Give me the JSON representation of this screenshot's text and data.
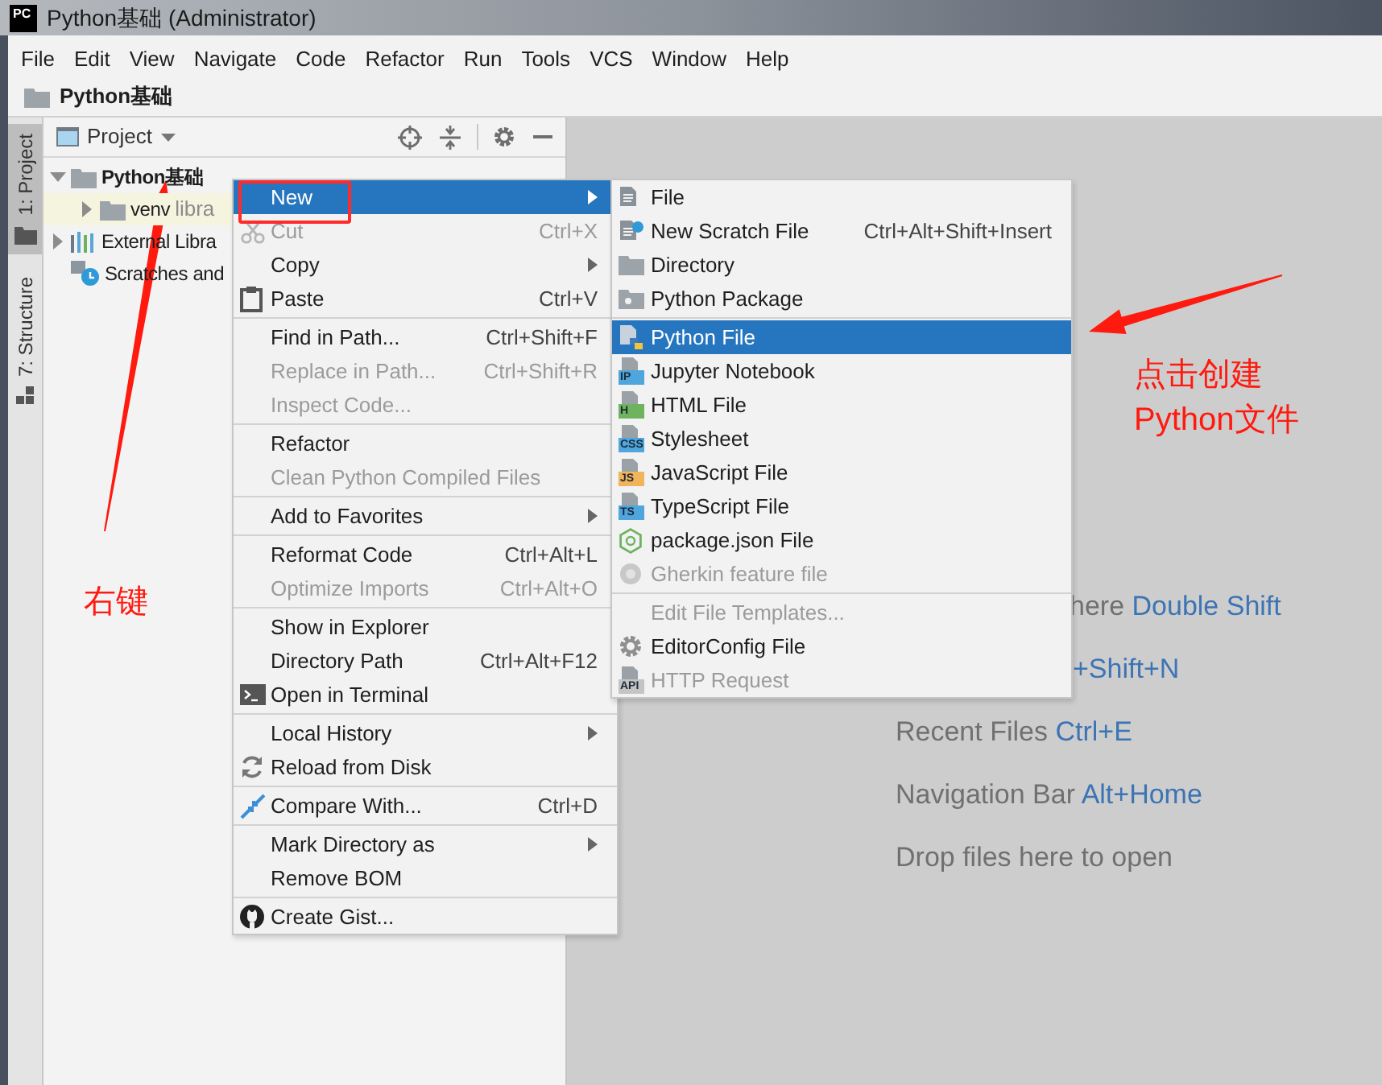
{
  "window": {
    "app_icon_text": "PC",
    "title": "Python基础 (Administrator)"
  },
  "menu_bar": [
    "File",
    "Edit",
    "View",
    "Navigate",
    "Code",
    "Refactor",
    "Run",
    "Tools",
    "VCS",
    "Window",
    "Help"
  ],
  "nav_bar": {
    "label": "Python基础"
  },
  "tool_tabs": [
    {
      "label": "1: Project",
      "selected": true
    },
    {
      "label": "7: Structure",
      "selected": false
    }
  ],
  "project_panel": {
    "title": "Project",
    "tree": [
      {
        "kind": "folder",
        "label": "Python基础",
        "expanded": true,
        "highlighted": false,
        "children": [
          {
            "kind": "folder",
            "label": "venv",
            "note": "libra",
            "expanded": false,
            "highlighted": true
          }
        ]
      },
      {
        "kind": "library",
        "label": "External Libra",
        "expanded": false,
        "highlighted": false
      },
      {
        "kind": "scratches",
        "label": "Scratches and",
        "highlighted": false
      }
    ]
  },
  "context_menu": {
    "groups": [
      [
        {
          "label": "New",
          "selected": true,
          "disabled": false,
          "submenu": true
        },
        {
          "label": "Cut",
          "shortcut": "Ctrl+X",
          "selected": false,
          "disabled": true,
          "submenu": false
        },
        {
          "label": "Copy",
          "selected": false,
          "disabled": false,
          "submenu": true
        },
        {
          "label": "Paste",
          "shortcut": "Ctrl+V",
          "selected": false,
          "disabled": false,
          "submenu": false
        }
      ],
      [
        {
          "label": "Find in Path...",
          "shortcut": "Ctrl+Shift+F",
          "selected": false,
          "disabled": false,
          "submenu": false
        },
        {
          "label": "Replace in Path...",
          "shortcut": "Ctrl+Shift+R",
          "selected": false,
          "disabled": true,
          "submenu": false
        },
        {
          "label": "Inspect Code...",
          "selected": false,
          "disabled": true,
          "submenu": false
        }
      ],
      [
        {
          "label": "Refactor",
          "selected": false,
          "disabled": false,
          "submenu": false
        },
        {
          "label": "Clean Python Compiled Files",
          "selected": false,
          "disabled": true,
          "submenu": false
        }
      ],
      [
        {
          "label": "Add to Favorites",
          "selected": false,
          "disabled": false,
          "submenu": true
        }
      ],
      [
        {
          "label": "Reformat Code",
          "shortcut": "Ctrl+Alt+L",
          "selected": false,
          "disabled": false,
          "submenu": false
        },
        {
          "label": "Optimize Imports",
          "shortcut": "Ctrl+Alt+O",
          "selected": false,
          "disabled": true,
          "submenu": false
        }
      ],
      [
        {
          "label": "Show in Explorer",
          "selected": false,
          "disabled": false,
          "submenu": false
        },
        {
          "label": "Directory Path",
          "shortcut": "Ctrl+Alt+F12",
          "selected": false,
          "disabled": false,
          "submenu": false
        },
        {
          "label": "Open in Terminal",
          "selected": false,
          "disabled": false,
          "submenu": false
        }
      ],
      [
        {
          "label": "Local History",
          "selected": false,
          "disabled": false,
          "submenu": true
        },
        {
          "label": "Reload from Disk",
          "selected": false,
          "disabled": false,
          "submenu": false
        }
      ],
      [
        {
          "label": "Compare With...",
          "shortcut": "Ctrl+D",
          "selected": false,
          "disabled": false,
          "submenu": false
        }
      ],
      [
        {
          "label": "Mark Directory as",
          "selected": false,
          "disabled": false,
          "submenu": true
        },
        {
          "label": "Remove BOM",
          "selected": false,
          "disabled": false,
          "submenu": false
        }
      ],
      [
        {
          "label": "Create Gist...",
          "selected": false,
          "disabled": false,
          "submenu": false
        }
      ]
    ]
  },
  "new_submenu": {
    "groups": [
      [
        {
          "label": "File",
          "selected": false,
          "disabled": false
        },
        {
          "label": "New Scratch File",
          "shortcut": "Ctrl+Alt+Shift+Insert",
          "selected": false,
          "disabled": false
        },
        {
          "label": "Directory",
          "selected": false,
          "disabled": false
        },
        {
          "label": "Python Package",
          "selected": false,
          "disabled": false
        }
      ],
      [
        {
          "label": "Python File",
          "selected": true,
          "disabled": false
        },
        {
          "label": "Jupyter Notebook",
          "badge": "IP",
          "color": "#4ea6dc",
          "selected": false,
          "disabled": false
        },
        {
          "label": "HTML File",
          "badge": "H",
          "color": "#6fb35f",
          "selected": false,
          "disabled": false
        },
        {
          "label": "Stylesheet",
          "badge": "CSS",
          "color": "#4ea6dc",
          "selected": false,
          "disabled": false
        },
        {
          "label": "JavaScript File",
          "badge": "JS",
          "color": "#f0b45a",
          "selected": false,
          "disabled": false
        },
        {
          "label": "TypeScript File",
          "badge": "TS",
          "color": "#4ea6dc",
          "selected": false,
          "disabled": false
        },
        {
          "label": "package.json File",
          "selected": false,
          "disabled": false
        },
        {
          "label": "Gherkin feature file",
          "selected": false,
          "disabled": true
        }
      ],
      [
        {
          "label": "Edit File Templates...",
          "selected": false,
          "disabled": true
        },
        {
          "label": "EditorConfig File",
          "selected": false,
          "disabled": false
        },
        {
          "label": "HTTP Request",
          "badge": "API",
          "color": "#c4c4c4",
          "selected": false,
          "disabled": true
        }
      ]
    ]
  },
  "editor_hints": [
    {
      "text": "here",
      "shortcut": "Double Shift"
    },
    {
      "shortcut": "+Shift+N"
    },
    {
      "text": "Recent Files",
      "shortcut": "Ctrl+E"
    },
    {
      "text": "Navigation Bar",
      "shortcut": "Alt+Home"
    },
    {
      "text": "Drop files here to open"
    }
  ],
  "annotations": [
    {
      "text": "右键"
    },
    {
      "text": "点击创建\nPython文件"
    }
  ]
}
